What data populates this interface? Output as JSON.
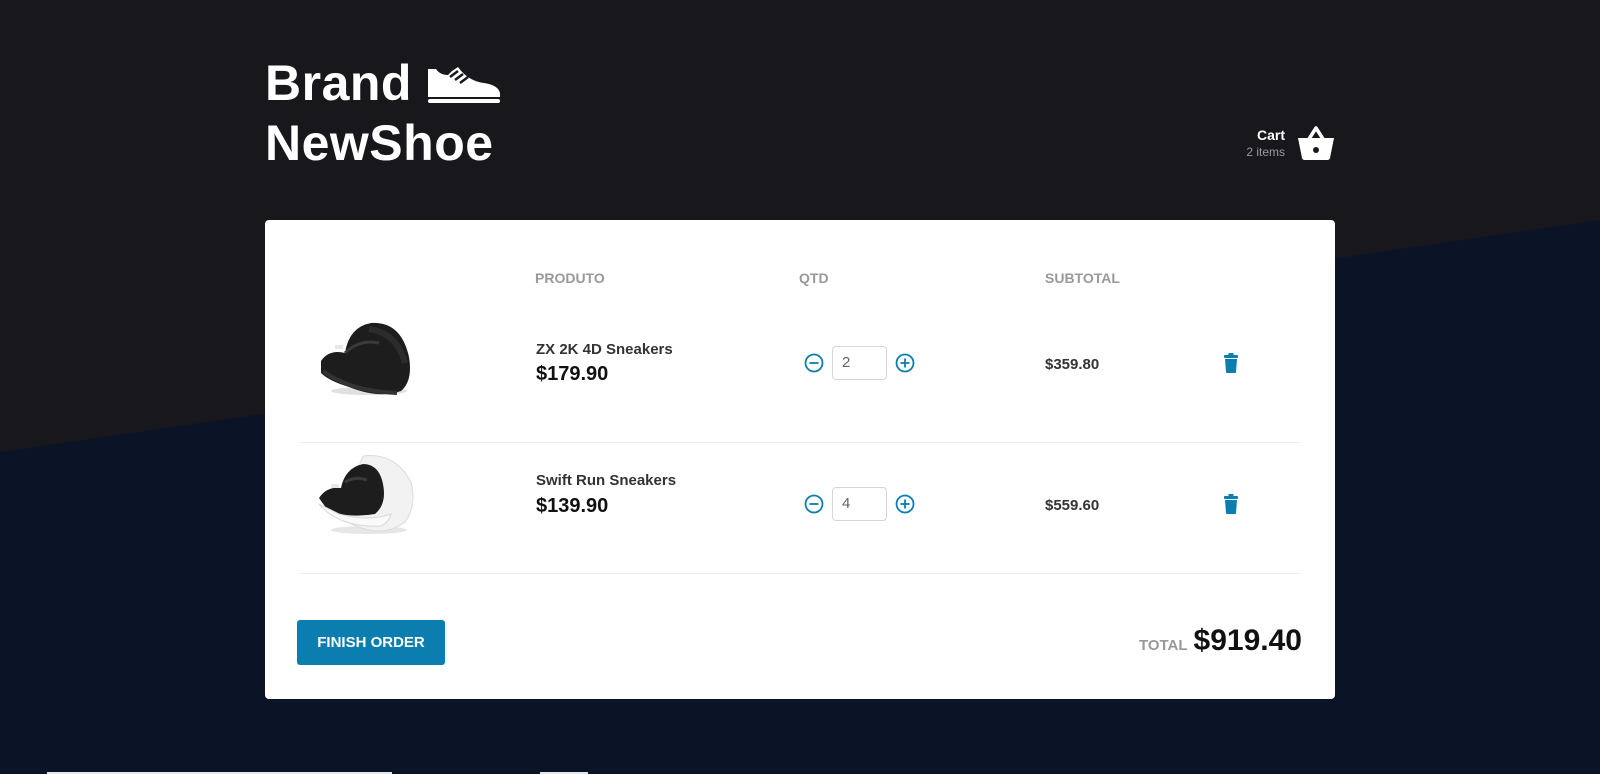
{
  "brand": {
    "line1": "Brand",
    "line2": "NewShoe",
    "logo_icon": "sneaker-icon"
  },
  "cart": {
    "title": "Cart",
    "count": "2 items",
    "icon": "basket-icon"
  },
  "table": {
    "headers": {
      "product": "PRODUTO",
      "qty": "QTD",
      "subtotal": "SUBTOTAL"
    },
    "rows": [
      {
        "name": "ZX 2K 4D Sneakers",
        "price": "$179.90",
        "quantity": "2",
        "subtotal": "$359.80",
        "image": "black-sneaker"
      },
      {
        "name": "Swift Run Sneakers",
        "price": "$139.90",
        "quantity": "4",
        "subtotal": "$559.60",
        "image": "black-white-sneaker"
      }
    ]
  },
  "footer": {
    "finish_label": "FINISH ORDER",
    "total_label": "TOTAL",
    "total_value": "$919.40"
  },
  "colors": {
    "top_background": "#18171c",
    "bottom_background": "#0b1426",
    "accent": "#0b7dae"
  }
}
